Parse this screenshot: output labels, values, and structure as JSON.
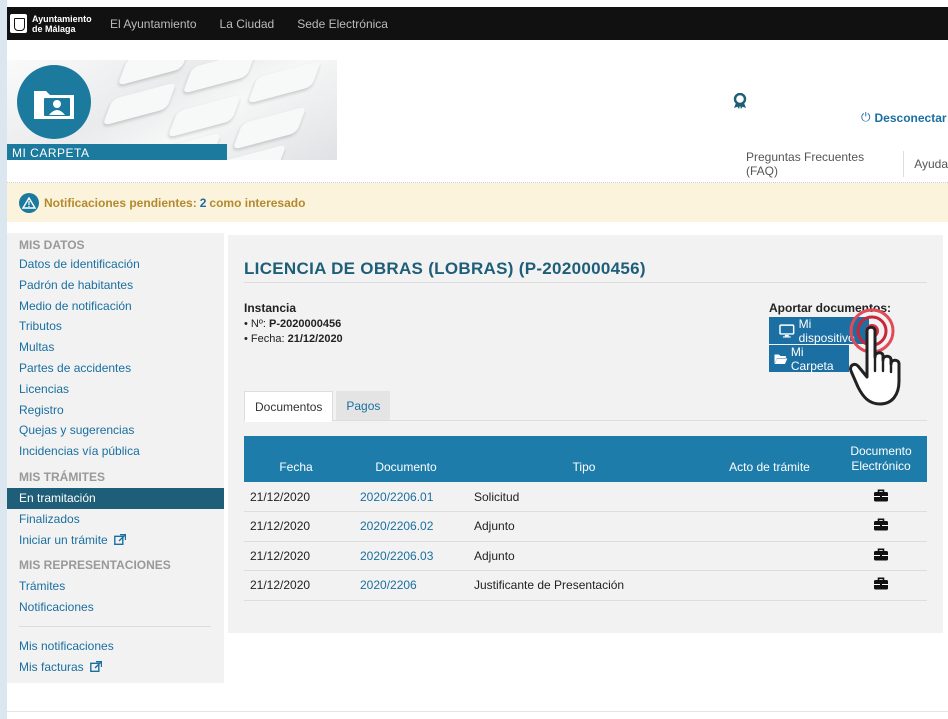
{
  "topbar": {
    "logo_line1": "Ayuntamiento",
    "logo_line2": "de Málaga",
    "nav": [
      "El Ayuntamiento",
      "La Ciudad",
      "Sede Electrónica"
    ]
  },
  "header": {
    "banner_label": "MI CARPETA",
    "logout_label": "Desconectar",
    "faq_label": "Preguntas Frecuentes (FAQ)",
    "help_label": "Ayuda",
    "accent_color": "#1b7a9d"
  },
  "alert": {
    "prefix": "Notificaciones pendientes:",
    "count": "2",
    "suffix": "como interesado"
  },
  "sidebar": {
    "mis_datos": {
      "heading": "MIS DATOS",
      "items": [
        "Datos de identificación",
        "Padrón de habitantes",
        "Medio de notificación",
        "Tributos",
        "Multas",
        "Partes de accidentes",
        "Licencias",
        "Registro",
        "Quejas y sugerencias",
        "Incidencias vía pública"
      ]
    },
    "mis_tramites": {
      "heading": "MIS TRÁMITES",
      "items": [
        "En tramitación",
        "Finalizados",
        "Iniciar un trámite"
      ]
    },
    "mis_representaciones": {
      "heading": "MIS REPRESENTACIONES",
      "items": [
        "Trámites",
        "Notificaciones"
      ]
    },
    "extra": [
      "Mis notificaciones",
      "Mis facturas"
    ]
  },
  "main": {
    "title": "LICENCIA DE OBRAS (LOBRAS) (P-2020000456)",
    "instancia_label": "Instancia",
    "numero_label": "Nº:",
    "numero_value": "P-2020000456",
    "fecha_label": "Fecha:",
    "fecha_value": "21/12/2020",
    "aportar_label": "Aportar documentos:",
    "btn_device": "Mi dispositivo",
    "btn_folder": "Mi Carpeta",
    "tabs": [
      "Documentos",
      "Pagos"
    ],
    "table": {
      "headers": [
        "Fecha",
        "Documento",
        "Tipo",
        "Acto de trámite",
        "Documento",
        "Electrónico"
      ],
      "rows": [
        {
          "fecha": "21/12/2020",
          "documento": "2020/2206.01",
          "tipo": "Solicitud",
          "acto": ""
        },
        {
          "fecha": "21/12/2020",
          "documento": "2020/2206.02",
          "tipo": "Adjunto",
          "acto": ""
        },
        {
          "fecha": "21/12/2020",
          "documento": "2020/2206.03",
          "tipo": "Adjunto",
          "acto": ""
        },
        {
          "fecha": "21/12/2020",
          "documento": "2020/2206",
          "tipo": "Justificante de Presentación",
          "acto": ""
        }
      ]
    }
  }
}
